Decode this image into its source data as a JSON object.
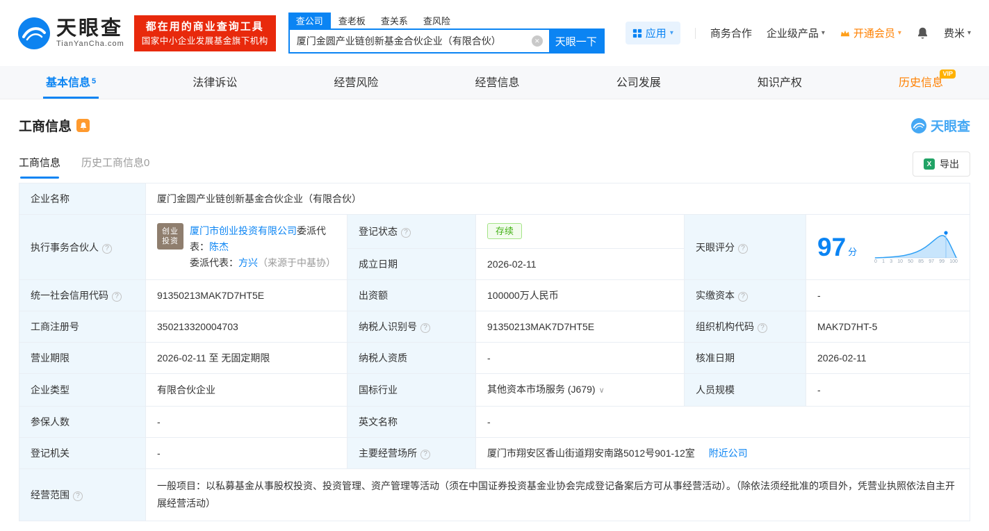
{
  "icons": {
    "info": "?",
    "clear": "✕",
    "caret": "▾",
    "chevron": "∨",
    "excel": "X"
  },
  "brand": {
    "name": "天眼查",
    "domain": "TianYanCha.com",
    "banner_line1": "都在用的商业查询工具",
    "banner_line2": "国家中小企业发展基金旗下机构"
  },
  "search": {
    "tabs": [
      "查公司",
      "查老板",
      "查关系",
      "查风险"
    ],
    "value": "厦门金圆产业链创新基金合伙企业（有限合伙）",
    "button": "天眼一下"
  },
  "top_nav": {
    "app": "应用",
    "cooperation": "商务合作",
    "enterprise": "企业级产品",
    "vip": "开通会员",
    "user": "费米"
  },
  "main_tabs": [
    {
      "label": "基本信息",
      "count": "5"
    },
    {
      "label": "法律诉讼"
    },
    {
      "label": "经营风险"
    },
    {
      "label": "经营信息"
    },
    {
      "label": "公司发展"
    },
    {
      "label": "知识产权"
    },
    {
      "label": "历史信息",
      "badge": "VIP"
    }
  ],
  "section": {
    "title": "工商信息",
    "watermark": "天眼查",
    "subtab_active": "工商信息",
    "subtab_history": "历史工商信息",
    "subtab_history_count": "0",
    "export_label": "导出"
  },
  "table": {
    "company_name": {
      "label": "企业名称",
      "value": "厦门金圆产业链创新基金合伙企业（有限合伙）"
    },
    "partner": {
      "label": "执行事务合伙人",
      "badge_line1": "创业",
      "badge_line2": "投资",
      "company": "厦门市创业投资有限公司",
      "rep_prefix": "委派代表：",
      "rep_name": "陈杰",
      "rep2_prefix": "委派代表：",
      "rep2_name": "方兴",
      "rep2_source": "（来源于中基协）"
    },
    "reg_status": {
      "label": "登记状态",
      "value": "存续"
    },
    "establish_date": {
      "label": "成立日期",
      "value": "2026-02-11"
    },
    "score": {
      "label": "天眼评分",
      "value": "97",
      "unit": "分",
      "axis": [
        "0",
        "1",
        "3",
        "10",
        "50",
        "85",
        "97",
        "99",
        "100"
      ]
    },
    "credit_code": {
      "label": "统一社会信用代码",
      "value": "91350213MAK7D7HT5E"
    },
    "capital": {
      "label": "出资额",
      "value": "100000万人民币"
    },
    "paid_capital": {
      "label": "实缴资本",
      "value": "-"
    },
    "reg_number": {
      "label": "工商注册号",
      "value": "350213320004703"
    },
    "taxpayer_id": {
      "label": "纳税人识别号",
      "value": "91350213MAK7D7HT5E"
    },
    "org_code": {
      "label": "组织机构代码",
      "value": "MAK7D7HT-5"
    },
    "business_term": {
      "label": "营业期限",
      "value": "2026-02-11 至 无固定期限"
    },
    "taxpayer_quality": {
      "label": "纳税人资质",
      "value": "-"
    },
    "approval_date": {
      "label": "核准日期",
      "value": "2026-02-11"
    },
    "company_type": {
      "label": "企业类型",
      "value": "有限合伙企业"
    },
    "industry": {
      "label": "国标行业",
      "value": "其他资本市场服务 (J679)"
    },
    "staff_size": {
      "label": "人员规模",
      "value": "-"
    },
    "insured_count": {
      "label": "参保人数",
      "value": "-"
    },
    "english_name": {
      "label": "英文名称",
      "value": "-"
    },
    "reg_authority": {
      "label": "登记机关",
      "value": "-"
    },
    "address": {
      "label": "主要经营场所",
      "value": "厦门市翔安区香山街道翔安南路5012号901-12室",
      "nearby_label": "附近公司"
    },
    "business_scope": {
      "label": "经营范围",
      "value": "一般项目：以私募基金从事股权投资、投资管理、资产管理等活动（须在中国证券投资基金业协会完成登记备案后方可从事经营活动）。（除依法须经批准的项目外，凭营业执照依法自主开展经营活动）"
    }
  }
}
